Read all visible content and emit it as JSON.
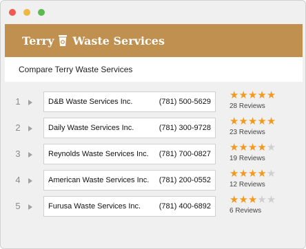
{
  "window": {
    "controls": [
      "close",
      "minimize",
      "zoom"
    ]
  },
  "brand": {
    "name_left": "Terry",
    "name_right": "Waste Services",
    "icon": "trash-bin-icon",
    "color": "#bf9050"
  },
  "subheader": {
    "title": "Compare Terry Waste Services"
  },
  "colors": {
    "star_on": "#f39a1e",
    "star_off": "#cfcfcf"
  },
  "rows": [
    {
      "rank": "1",
      "company": "D&B Waste Services Inc.",
      "phone": "(781) 500-5629",
      "stars": 5,
      "reviews": "28 Reviews"
    },
    {
      "rank": "2",
      "company": "Daily Waste Services Inc.",
      "phone": "(781) 300-9728",
      "stars": 5,
      "reviews": "23 Reviews"
    },
    {
      "rank": "3",
      "company": "Reynolds Waste Services Inc.",
      "phone": "(781) 700-0827",
      "stars": 4,
      "reviews": "19 Reviews"
    },
    {
      "rank": "4",
      "company": "American Waste Services Inc.",
      "phone": "(781) 200-0552",
      "stars": 4,
      "reviews": "12 Reviews"
    },
    {
      "rank": "5",
      "company": "Furusa Waste Services Inc.",
      "phone": "(781) 400-6892",
      "stars": 3,
      "reviews": "6 Reviews"
    }
  ]
}
